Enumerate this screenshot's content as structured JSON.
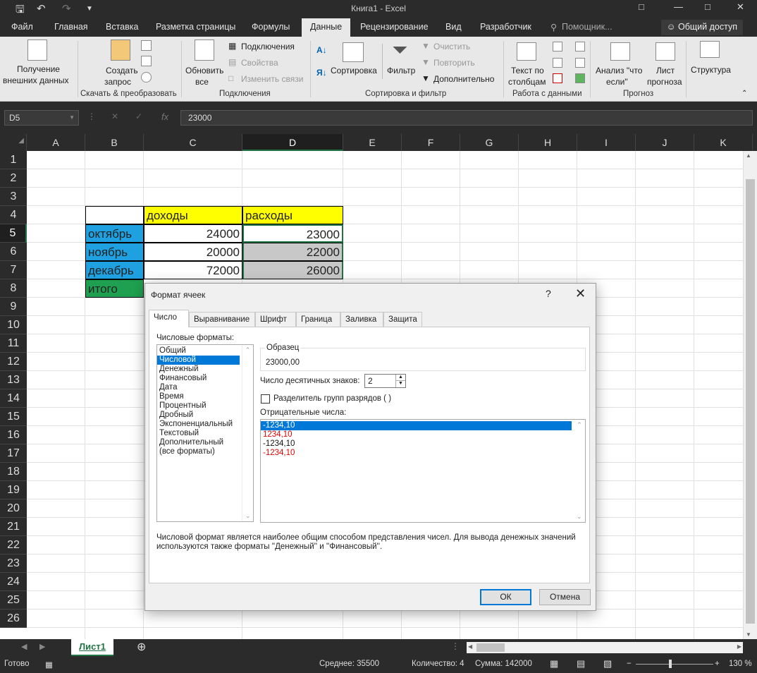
{
  "window": {
    "title": "Книга1 - Excel"
  },
  "ribbon_tabs": [
    "Файл",
    "Главная",
    "Вставка",
    "Разметка страницы",
    "Формулы",
    "Данные",
    "Рецензирование",
    "Вид",
    "Разработчик",
    "Помощник...",
    "Общий доступ"
  ],
  "ribbon": {
    "get_external_1": "Получение",
    "get_external_2": "внешних данных",
    "create_query_1": "Создать",
    "create_query_2": "запрос",
    "group_transform": "Скачать & преобразовать",
    "refresh_1": "Обновить",
    "refresh_2": "все",
    "connections": "Подключения",
    "properties": "Свойства",
    "edit_links": "Изменить связи",
    "group_connections": "Подключения",
    "sort": "Сортировка",
    "filter": "Фильтр",
    "clear": "Очистить",
    "reapply": "Повторить",
    "advanced": "Дополнительно",
    "group_sort": "Сортировка и фильтр",
    "text_cols_1": "Текст по",
    "text_cols_2": "столбцам",
    "group_data_tools": "Работа с данными",
    "whatif_1": "Анализ \"что",
    "whatif_2": "если\"",
    "forecast_1": "Лист",
    "forecast_2": "прогноза",
    "group_forecast": "Прогноз",
    "outline": "Структура"
  },
  "formula_bar": {
    "name_box": "D5",
    "fx": "fx",
    "value": "23000"
  },
  "columns": [
    "A",
    "B",
    "C",
    "D",
    "E",
    "F",
    "G",
    "H",
    "I",
    "J",
    "K"
  ],
  "rows": [
    "1",
    "2",
    "3",
    "4",
    "5",
    "6",
    "7",
    "8",
    "9",
    "10",
    "11",
    "12",
    "13",
    "14",
    "15",
    "16",
    "17",
    "18",
    "19",
    "20",
    "21",
    "22",
    "23",
    "24",
    "25",
    "26"
  ],
  "table": {
    "hdr_income": "доходы",
    "hdr_expense": "расходы",
    "rows": [
      {
        "month": "октябрь",
        "income": "24000",
        "expense": "23000"
      },
      {
        "month": "ноябрь",
        "income": "20000",
        "expense": "22000"
      },
      {
        "month": "декабрь",
        "income": "72000",
        "expense": "26000"
      }
    ],
    "total": "итого"
  },
  "colors": {
    "yellow": "#ffff00",
    "blue": "#1fa0e0",
    "green": "#1fa050",
    "selected_gray": "#c8c8c8",
    "accent": "#217346"
  },
  "dialog": {
    "title": "Формат ячеек",
    "help": "?",
    "close": "✕",
    "tabs": [
      "Число",
      "Выравнивание",
      "Шрифт",
      "Граница",
      "Заливка",
      "Защита"
    ],
    "formats_label": "Числовые форматы:",
    "formats": [
      "Общий",
      "Числовой",
      "Денежный",
      "Финансовый",
      "Дата",
      "Время",
      "Процентный",
      "Дробный",
      "Экспоненциальный",
      "Текстовый",
      "Дополнительный",
      "(все форматы)"
    ],
    "sample_label": "Образец",
    "sample_value": "23000,00",
    "decimals_label": "Число десятичных знаков:",
    "decimals_value": "2",
    "separator_label": "Разделитель групп разрядов ( )",
    "negative_label": "Отрицательные числа:",
    "negatives": [
      "-1234,10",
      "1234,10",
      "-1234,10",
      "-1234,10"
    ],
    "description": "Числовой формат является наиболее общим способом представления чисел. Для вывода денежных значений используются также форматы ''Денежный'' и ''Финансовый''.",
    "ok": "ОК",
    "cancel": "Отмена"
  },
  "sheet_tab": "Лист1",
  "status": {
    "ready": "Готово",
    "average": "Среднее: 35500",
    "count": "Количество: 4",
    "sum": "Сумма: 142000",
    "zoom": "130 %"
  }
}
